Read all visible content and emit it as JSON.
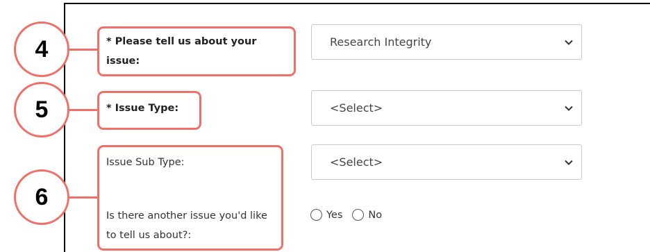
{
  "steps": [
    "4",
    "5",
    "6"
  ],
  "fields": {
    "issue_about": {
      "label": "* Please tell us about your issue:",
      "value": "Research Integrity"
    },
    "issue_type": {
      "label": "* Issue Type:",
      "value": "<Select>"
    },
    "issue_sub_type": {
      "label": "Issue Sub Type:",
      "value": "<Select>"
    },
    "another_issue": {
      "label": "Is there another issue you'd like to tell us about?:",
      "options": [
        "Yes",
        "No"
      ]
    }
  },
  "colors": {
    "highlight": "#f07068"
  }
}
